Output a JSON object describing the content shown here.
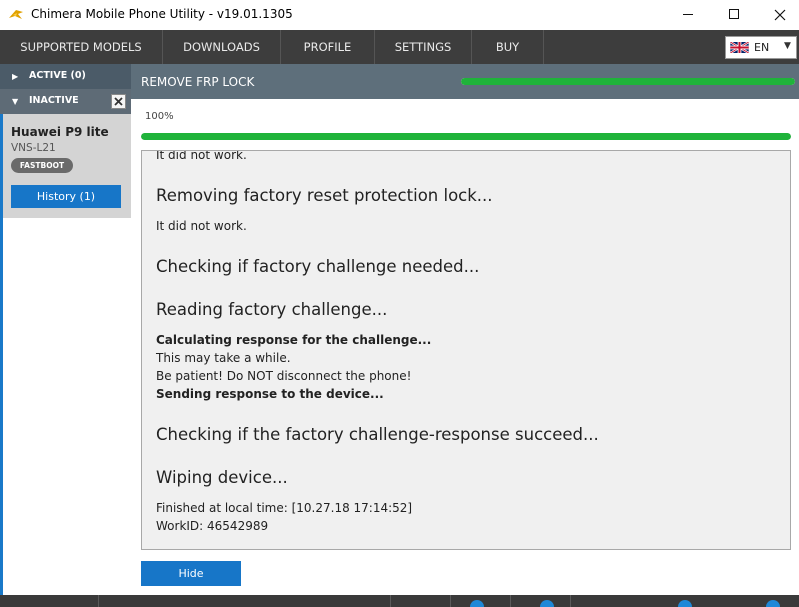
{
  "window": {
    "title": "Chimera Mobile Phone Utility - v19.01.1305"
  },
  "menu": {
    "supported_models": "SUPPORTED MODELS",
    "downloads": "DOWNLOADS",
    "profile": "PROFILE",
    "settings": "SETTINGS",
    "buy": "BUY",
    "language": "EN"
  },
  "sidebar": {
    "active_label": "ACTIVE (0)",
    "inactive_label": "INACTIVE",
    "device": {
      "name": "Huawei P9 lite",
      "model": "VNS-L21",
      "mode_badge": "FASTBOOT",
      "history_button": "History (1)"
    }
  },
  "operation": {
    "title": "REMOVE FRP LOCK",
    "progress_percent": 100,
    "progress_text": "100%",
    "log": [
      "It did not work.",
      "Removing factory reset protection lock...",
      "It did not work.",
      "Checking if factory challenge needed...",
      "Reading factory challenge...",
      "Calculating response for the challenge...",
      "This may take a while.",
      "Be patient! Do NOT disconnect the phone!",
      "Sending response to the device...",
      "Checking if the factory challenge-response succeed...",
      "Wiping device...",
      "Finished at local time: [10.27.18 17:14:52]",
      "WorkID: 46542989"
    ],
    "hide_button": "Hide"
  },
  "colors": {
    "accent_blue": "#1776c8",
    "progress_green": "#1fb33a",
    "menu_bg": "#3d3d3d",
    "header_bg": "#5e6f7b"
  },
  "icons": {
    "app": "chimera-logo-icon",
    "minimize": "minimize-icon",
    "maximize": "maximize-icon",
    "close": "close-icon",
    "flag": "uk-flag-icon",
    "dropdown": "chevron-down-icon",
    "collapsed": "triangle-right-icon",
    "expanded": "triangle-down-icon"
  }
}
